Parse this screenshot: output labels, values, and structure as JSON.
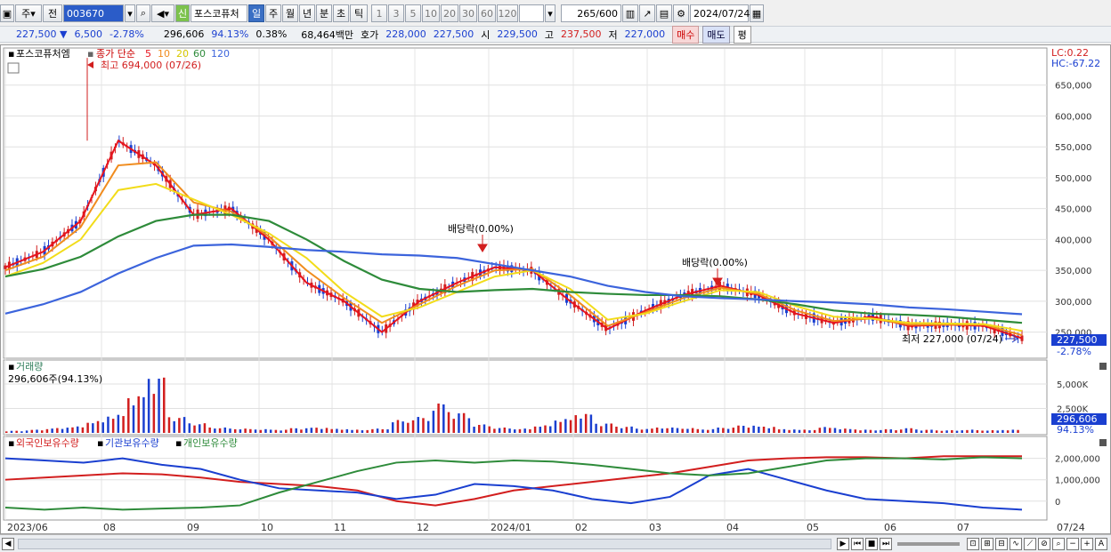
{
  "toolbar": {
    "period_select": "주",
    "prev_label": "전",
    "code": "003670",
    "name": "포스코퓨처",
    "new_badge": "신",
    "periods": [
      "일",
      "주",
      "월",
      "년",
      "분",
      "초",
      "틱"
    ],
    "active_period": "일",
    "intervals": [
      "1",
      "3",
      "5",
      "10",
      "20",
      "30",
      "60",
      "120"
    ],
    "count": "265",
    "count_total": "/600",
    "date": "2024/07/24"
  },
  "quote": {
    "price": "227,500",
    "direction": "▼",
    "change": "6,500",
    "change_rate": "-2.78%",
    "volume": "296,606",
    "volume_rate": "94.13%",
    "turnover_rate": "0.38%",
    "amount": "68,464백만",
    "bid_label": "호가",
    "bid": "228,000",
    "ask": "227,500",
    "open_label": "시",
    "open": "229,500",
    "high_label": "고",
    "high": "237,500",
    "low_label": "저",
    "low": "227,000",
    "buy_label": "매수",
    "sell_label": "매도",
    "avg_label": "평"
  },
  "legend": {
    "name": "포스코퓨처엠",
    "ma_label": "종가 단순",
    "ma5": "5",
    "ma10": "10",
    "ma20": "20",
    "ma60": "60",
    "ma120": "120",
    "lc": "LC:0.22",
    "hc": "HC:-67.22",
    "high_note": "최고 694,000 (07/26)",
    "low_note": "최저 227,000 (07/24)",
    "dividend_1": "배당락(0.00%)",
    "dividend_2": "배당락(0.00%)",
    "last_price": "227,500",
    "last_rate": "-2.78%"
  },
  "volume_panel": {
    "title": "거래량",
    "value": "296,606주(94.13%)",
    "last_value": "296,606",
    "last_rate": "94.13%"
  },
  "holdings_panel": {
    "foreign": "외국인보유수량",
    "institution": "기관보유수량",
    "individual": "개인보유수량"
  },
  "colors": {
    "up": "#d21e1e",
    "down": "#1a3fd0",
    "ma5": "#e8141e",
    "ma10": "#f08c1e",
    "ma20": "#f5e61e",
    "ma60": "#2e8b3a",
    "ma120": "#3c64dc"
  },
  "chart_data": [
    {
      "type": "line",
      "title": "포스코퓨처엠",
      "x": [
        "2023/06",
        "08",
        "09",
        "10",
        "11",
        "12",
        "2024/01",
        "02",
        "03",
        "04",
        "05",
        "06",
        "07",
        "07/24"
      ],
      "ylim": [
        225000,
        700000
      ],
      "y_ticks": [
        "250,000",
        "300,000",
        "350,000",
        "400,000",
        "450,000",
        "500,000",
        "550,000",
        "600,000",
        "650,000"
      ],
      "series": [
        {
          "name": "5",
          "values": [
            355000,
            380000,
            430000,
            560000,
            520000,
            440000,
            450000,
            400000,
            330000,
            300000,
            250000,
            300000,
            330000,
            355000,
            350000,
            300000,
            255000,
            285000,
            310000,
            325000,
            310000,
            280000,
            265000,
            275000,
            260000,
            262000,
            260000,
            240000
          ]
        },
        {
          "name": "10",
          "values": [
            350000,
            372000,
            420000,
            520000,
            525000,
            460000,
            445000,
            405000,
            350000,
            305000,
            265000,
            295000,
            325000,
            350000,
            352000,
            310000,
            260000,
            282000,
            305000,
            322000,
            312000,
            285000,
            268000,
            272000,
            262000,
            262000,
            262000,
            245000
          ]
        },
        {
          "name": "20",
          "values": [
            340000,
            362000,
            400000,
            480000,
            490000,
            465000,
            440000,
            410000,
            370000,
            315000,
            275000,
            290000,
            315000,
            340000,
            350000,
            320000,
            270000,
            280000,
            300000,
            318000,
            315000,
            292000,
            275000,
            272000,
            265000,
            264000,
            263000,
            252000
          ]
        },
        {
          "name": "60",
          "values": [
            340000,
            352000,
            372000,
            405000,
            430000,
            440000,
            440000,
            430000,
            400000,
            365000,
            335000,
            320000,
            315000,
            318000,
            320000,
            315000,
            312000,
            310000,
            310000,
            308000,
            303000,
            295000,
            285000,
            280000,
            278000,
            275000,
            270000,
            265000
          ]
        },
        {
          "name": "120",
          "values": [
            280000,
            295000,
            315000,
            345000,
            370000,
            390000,
            392000,
            388000,
            383000,
            380000,
            376000,
            374000,
            370000,
            360000,
            350000,
            340000,
            325000,
            315000,
            308000,
            305000,
            303000,
            300000,
            298000,
            295000,
            290000,
            287000,
            283000,
            279000
          ]
        }
      ]
    },
    {
      "type": "bar",
      "title": "거래량",
      "y_ticks": [
        "5,000K",
        "2,500K",
        "0"
      ],
      "values": [
        200,
        300,
        450,
        600,
        1100,
        1700,
        3500,
        5300,
        1500,
        900,
        500,
        400,
        350,
        300,
        450,
        500,
        380,
        300,
        400,
        1200,
        1500,
        2800,
        1900,
        800,
        500,
        400,
        700,
        1300,
        1800,
        900,
        600,
        400,
        500,
        450,
        350,
        500,
        700,
        600,
        350,
        300,
        550,
        400,
        300,
        350,
        450,
        300,
        250,
        300,
        250,
        297
      ]
    },
    {
      "type": "line",
      "title": "보유수량",
      "y_ticks": [
        "2,000,000",
        "1,000,000",
        "0"
      ],
      "series": [
        {
          "name": "외국인보유수량",
          "values": [
            1000000,
            1100000,
            1200000,
            1300000,
            1250000,
            1100000,
            900000,
            800000,
            700000,
            500000,
            0,
            -200000,
            100000,
            500000,
            700000,
            900000,
            1100000,
            1300000,
            1600000,
            1900000,
            2000000,
            2050000,
            2050000,
            2000000,
            2100000,
            2100000,
            2100000
          ]
        },
        {
          "name": "기관보유수량",
          "values": [
            2000000,
            1900000,
            1800000,
            2000000,
            1700000,
            1500000,
            1000000,
            600000,
            500000,
            400000,
            100000,
            300000,
            800000,
            700000,
            500000,
            100000,
            -100000,
            200000,
            1200000,
            1500000,
            1000000,
            500000,
            100000,
            0,
            -100000,
            -300000,
            -400000
          ]
        },
        {
          "name": "개인보유수량",
          "values": [
            -300000,
            -400000,
            -300000,
            -400000,
            -350000,
            -300000,
            -200000,
            400000,
            900000,
            1400000,
            1800000,
            1900000,
            1800000,
            1900000,
            1850000,
            1700000,
            1500000,
            1300000,
            1200000,
            1300000,
            1600000,
            1900000,
            2000000,
            2000000,
            1950000,
            2050000,
            2000000
          ]
        }
      ]
    }
  ]
}
